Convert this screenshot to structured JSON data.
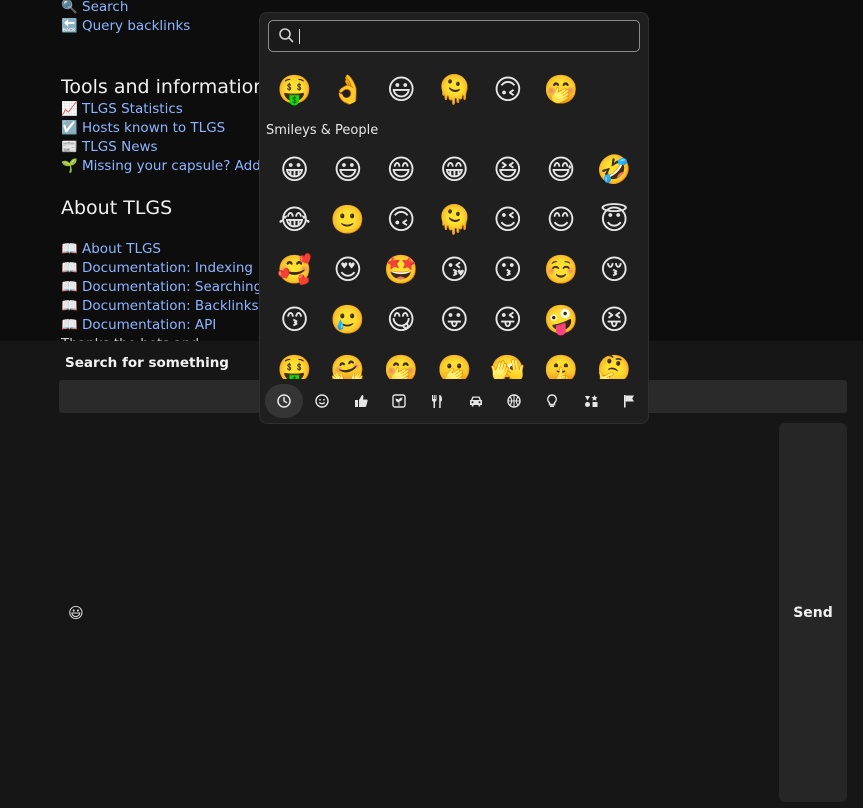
{
  "top_links": [
    {
      "emoji": "🔍",
      "text": "Search"
    },
    {
      "emoji": "🔙",
      "text": "Query backlinks"
    }
  ],
  "tools_section": {
    "title": "Tools and information",
    "links": [
      {
        "emoji": "📈",
        "text": "TLGS Statistics"
      },
      {
        "emoji": "☑️",
        "text": "Hosts known to TLGS"
      },
      {
        "emoji": "📰",
        "text": "TLGS News"
      },
      {
        "emoji": "🌱",
        "text": "Missing your capsule? Add it to TLGS"
      }
    ]
  },
  "about_section": {
    "title": "About TLGS",
    "links": [
      {
        "emoji": "📖",
        "text": "About TLGS"
      },
      {
        "emoji": "📖",
        "text": "Documentation: Indexing"
      },
      {
        "emoji": "📖",
        "text": "Documentation: Searching"
      },
      {
        "emoji": "📖",
        "text": "Documentation: Backlinks"
      },
      {
        "emoji": "📖",
        "text": "Documentation: API"
      }
    ],
    "partial_line": "Thanks the bots and"
  },
  "panel": {
    "header": "Search for something",
    "send_label": "Send",
    "smile_icon": "😃"
  },
  "picker": {
    "search_value": "",
    "recent": [
      "🤑",
      "👌",
      "😃",
      "🫠",
      "🙃",
      "🤭"
    ],
    "category_label": "Smileys & People",
    "emojis": [
      "😀",
      "😃",
      "😄",
      "😁",
      "😆",
      "😅",
      "🤣",
      "😂",
      "🙂",
      "🙃",
      "🫠",
      "😉",
      "😊",
      "😇",
      "🥰",
      "😍",
      "🤩",
      "😘",
      "😗",
      "☺️",
      "😚",
      "😙",
      "🥲",
      "😋",
      "😛",
      "😜",
      "🤪",
      "😝",
      "🤑",
      "🤗",
      "🤭",
      "🫢",
      "🫣",
      "🤫",
      "🤔"
    ],
    "categories": [
      {
        "name": "recent",
        "icon": "clock-icon",
        "active": true
      },
      {
        "name": "smileys",
        "icon": "smiley-icon",
        "active": false
      },
      {
        "name": "people",
        "icon": "thumbs-up-icon",
        "active": false
      },
      {
        "name": "nature",
        "icon": "plant-icon",
        "active": false
      },
      {
        "name": "food",
        "icon": "utensils-icon",
        "active": false
      },
      {
        "name": "travel",
        "icon": "car-icon",
        "active": false
      },
      {
        "name": "activities",
        "icon": "ball-icon",
        "active": false
      },
      {
        "name": "objects",
        "icon": "lightbulb-icon",
        "active": false
      },
      {
        "name": "symbols",
        "icon": "symbols-icon",
        "active": false
      },
      {
        "name": "flags",
        "icon": "flag-icon",
        "active": false
      }
    ]
  }
}
